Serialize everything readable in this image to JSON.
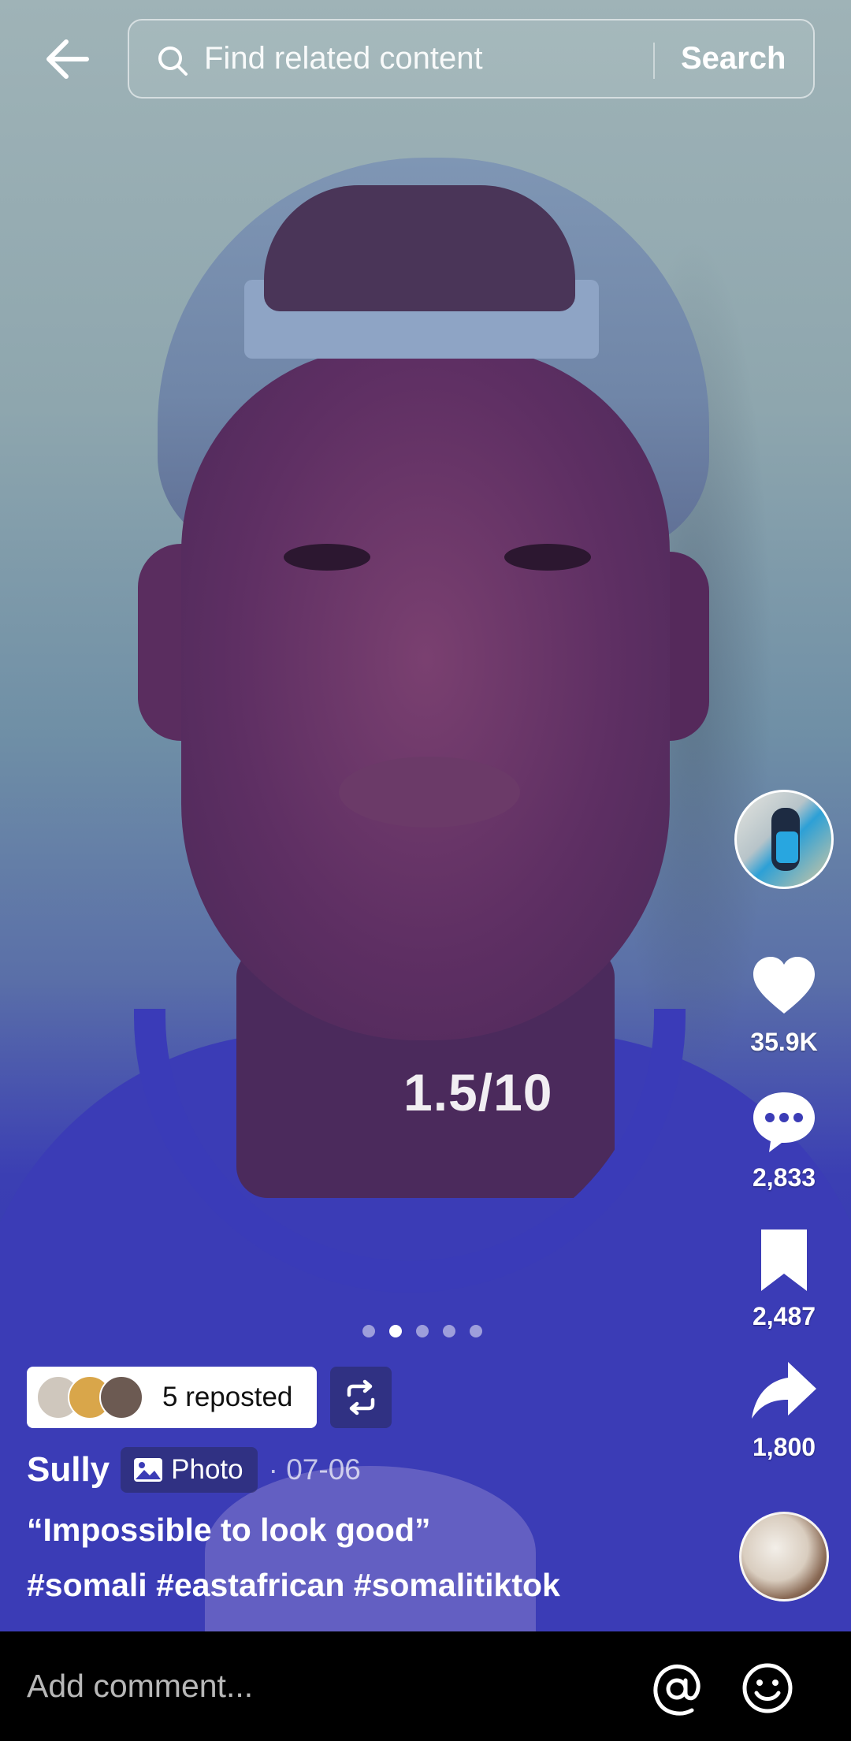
{
  "search": {
    "placeholder": "Find related content",
    "button_label": "Search"
  },
  "post": {
    "rating_text": "1.5/10",
    "pagination": {
      "total": 5,
      "active_index": 1
    },
    "repost": {
      "label": "5 reposted"
    },
    "author": "Sully",
    "type_tag": "Photo",
    "date": "· 07-06",
    "caption": "“Impossible to look good”",
    "hashtags": "#somali #eastafrican #somalitiktok"
  },
  "actions": {
    "likes": "35.9K",
    "comments": "2,833",
    "saves": "2,487",
    "shares": "1,800"
  },
  "comment_bar": {
    "placeholder": "Add comment..."
  },
  "icons": {
    "back": "back-arrow-icon",
    "search": "search-icon",
    "like": "heart-icon",
    "comment": "comment-icon",
    "save": "bookmark-icon",
    "share": "share-icon",
    "repost": "repost-icon",
    "photo": "photo-icon",
    "mention": "at-icon",
    "emoji": "emoji-icon"
  }
}
